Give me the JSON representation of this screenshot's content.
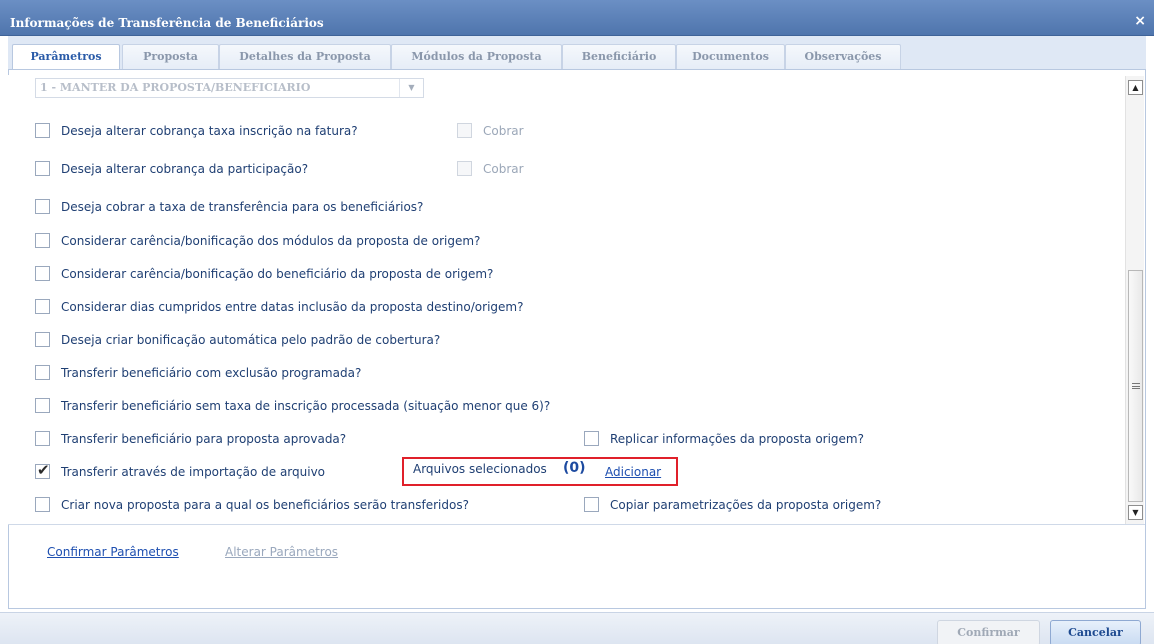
{
  "window": {
    "title": "Informações de Transferência de Beneficiários",
    "close_glyph": "×",
    "close_icon": "close-icon"
  },
  "tabs": [
    {
      "label": "Parâmetros",
      "active": true
    },
    {
      "label": "Proposta",
      "active": false
    },
    {
      "label": "Detalhes da Proposta",
      "active": false
    },
    {
      "label": "Módulos da Proposta",
      "active": false
    },
    {
      "label": "Beneficiário",
      "active": false
    },
    {
      "label": "Documentos",
      "active": false
    },
    {
      "label": "Observações",
      "active": false
    }
  ],
  "combo": {
    "value": "1 - MANTER DA PROPOSTA/BENEFICIARIO",
    "arrow_glyph": "▼"
  },
  "options": [
    {
      "label": "Deseja alterar cobrança taxa inscrição na fatura?",
      "checked": false,
      "extra": {
        "label": "Cobrar",
        "checked": false,
        "disabled": true
      }
    },
    {
      "label": "Deseja alterar cobrança da participação?",
      "checked": false,
      "extra": {
        "label": "Cobrar",
        "checked": false,
        "disabled": true
      }
    },
    {
      "label": "Deseja cobrar a taxa de transferência para os beneficiários?",
      "checked": false
    },
    {
      "label": "Considerar carência/bonificação dos módulos da proposta de origem?",
      "checked": false
    },
    {
      "label": "Considerar carência/bonificação do beneficiário da proposta de origem?",
      "checked": false
    },
    {
      "label": "Considerar dias cumpridos entre datas inclusão da proposta destino/origem?",
      "checked": false
    },
    {
      "label": "Deseja criar bonificação automática pelo padrão de cobertura?",
      "checked": false
    },
    {
      "label": "Transferir beneficiário com exclusão programada?",
      "checked": false
    },
    {
      "label": "Transferir beneficiário sem taxa de inscrição processada (situação menor que 6)?",
      "checked": false
    },
    {
      "label": "Transferir beneficiário para proposta aprovada?",
      "checked": false,
      "right": {
        "label": "Replicar informações da proposta origem?",
        "checked": false
      }
    },
    {
      "label": "Transferir através de importação de arquivo",
      "checked": true,
      "check_glyph": "✔"
    },
    {
      "label": "Criar nova proposta para a qual os beneficiários serão transferidos?",
      "checked": false,
      "right": {
        "label": "Copiar parametrizações da proposta origem?",
        "checked": false
      }
    }
  ],
  "files": {
    "label": "Arquivos selecionados",
    "count": "(0)",
    "add_link": "Adicionar"
  },
  "links": {
    "confirm_params": "Confirmar Parâmetros",
    "change_params": "Alterar Parâmetros"
  },
  "scrollbar": {
    "up_glyph": "▲",
    "down_glyph": "▼"
  },
  "footer": {
    "confirm": "Confirmar",
    "cancel": "Cancelar"
  },
  "colors": {
    "title_bar": "#5a7fb8",
    "highlight_border": "#e0202a",
    "link": "#1e4fb0"
  }
}
